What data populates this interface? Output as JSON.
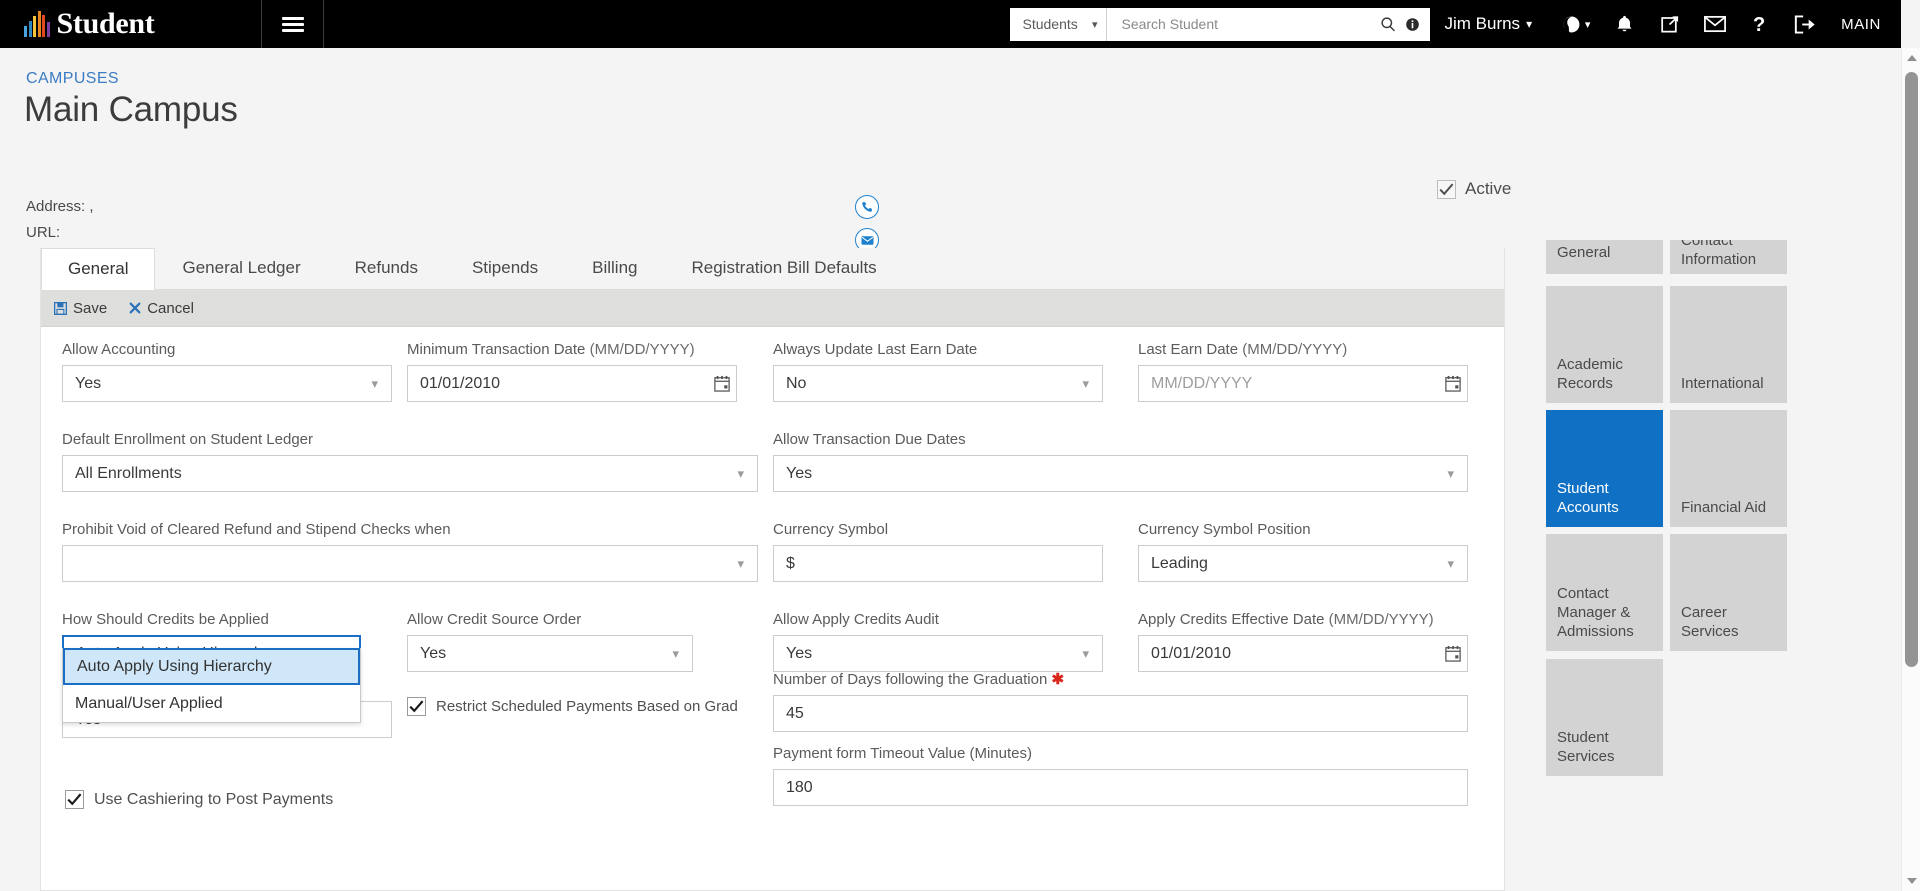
{
  "header": {
    "brand": "Student",
    "logo_bar_colors": [
      "#4aa3df",
      "#2e86c1",
      "#f2c53d",
      "#e8861f",
      "#e04a1f",
      "#7a3fa0"
    ],
    "menu_icon": "hamburger-icon",
    "search": {
      "scope_value": "Students",
      "placeholder": "Search Student",
      "value": "",
      "search_icon": "search-icon",
      "info_icon": "info-icon"
    },
    "user": {
      "name": "Jim Burns",
      "chevron": "chevron-down-icon"
    },
    "icons": [
      {
        "name": "globe-icon",
        "glyph": "globe"
      },
      {
        "name": "bell-icon",
        "glyph": "bell"
      },
      {
        "name": "external-link-icon",
        "glyph": "share"
      },
      {
        "name": "envelope-icon",
        "glyph": "mail"
      },
      {
        "name": "help-icon",
        "glyph": "question"
      },
      {
        "name": "logout-icon",
        "glyph": "logout"
      }
    ],
    "context_label": "MAIN"
  },
  "page": {
    "breadcrumb": "CAMPUSES",
    "title": "Main Campus",
    "address_label": "Address:",
    "address_value": ",",
    "url_label": "URL:",
    "url_value": "",
    "contact_icons": [
      {
        "name": "phone-icon"
      },
      {
        "name": "email-icon"
      }
    ],
    "active_checkbox": {
      "label": "Active",
      "checked": true
    }
  },
  "tabs": [
    {
      "label": "General",
      "active": true
    },
    {
      "label": "General Ledger",
      "active": false
    },
    {
      "label": "Refunds",
      "active": false
    },
    {
      "label": "Stipends",
      "active": false
    },
    {
      "label": "Billing",
      "active": false
    },
    {
      "label": "Registration Bill Defaults",
      "active": false
    }
  ],
  "toolbar": {
    "save_label": "Save",
    "cancel_label": "Cancel",
    "save_icon": "save-icon",
    "cancel_icon": "close-icon"
  },
  "form": {
    "allow_accounting": {
      "label": "Allow Accounting",
      "value": "Yes"
    },
    "minimum_transaction_date": {
      "label": "Minimum Transaction Date",
      "label_hint": "(MM/DD/YYYY)",
      "value": "01/01/2010"
    },
    "always_update_last_earn_date": {
      "label": "Always Update Last Earn Date",
      "value": "No"
    },
    "last_earn_date": {
      "label": "Last Earn Date",
      "label_hint": "(MM/DD/YYYY)",
      "value": "",
      "placeholder": "MM/DD/YYYY"
    },
    "default_enrollment": {
      "label": "Default Enrollment on Student Ledger",
      "value": "All Enrollments"
    },
    "allow_transaction_due_dates": {
      "label": "Allow Transaction Due Dates",
      "value": "Yes"
    },
    "prohibit_void": {
      "label": "Prohibit Void of Cleared Refund and Stipend Checks when",
      "value": ""
    },
    "currency_symbol": {
      "label": "Currency Symbol",
      "value": "$"
    },
    "currency_symbol_position": {
      "label": "Currency Symbol Position",
      "value": "Leading"
    },
    "how_credits_applied": {
      "label": "How Should Credits be Applied",
      "value": "Auto Apply Using Hierarchy",
      "open": true,
      "options": [
        "Auto Apply Using Hierarchy",
        "Manual/User Applied"
      ],
      "selected_option": "Auto Apply Using Hierarchy"
    },
    "obscured_field": {
      "value": "Yes"
    },
    "allow_credit_source_order": {
      "label": "Allow Credit Source Order",
      "value": "Yes"
    },
    "allow_apply_credits_audit": {
      "label": "Allow Apply Credits Audit",
      "value": "Yes"
    },
    "apply_credits_effective_date": {
      "label": "Apply Credits Effective Date",
      "label_hint": "(MM/DD/YYYY)",
      "value": "01/01/2010"
    },
    "restrict_scheduled_payments": {
      "label": "Restrict Scheduled Payments Based on Grad",
      "checked": true
    },
    "number_of_days_following_graduation": {
      "label": "Number of Days following the Graduation",
      "required": true,
      "value": "45"
    },
    "payment_form_timeout": {
      "label": "Payment form Timeout Value (Minutes)",
      "value": "180"
    },
    "use_cashiering": {
      "label": "Use Cashiering to Post Payments",
      "checked": true
    }
  },
  "tiles": [
    {
      "label": "General",
      "active": false
    },
    {
      "label": "Contact Information",
      "active": false
    },
    {
      "label": "Academic Records",
      "active": false
    },
    {
      "label": "International",
      "active": false
    },
    {
      "label": "Student Accounts",
      "active": true
    },
    {
      "label": "Financial Aid",
      "active": false
    },
    {
      "label": "Contact Manager & Admissions",
      "active": false
    },
    {
      "label": "Career Services",
      "active": false
    },
    {
      "label": "Student Services",
      "active": false
    }
  ],
  "colors": {
    "accent_blue": "#1071c4",
    "link_blue": "#3b7cc4",
    "topbar": "#000000",
    "toolbar_gray": "#dededd",
    "tile_gray": "#d3d3d3",
    "required_red": "#d9261c"
  }
}
